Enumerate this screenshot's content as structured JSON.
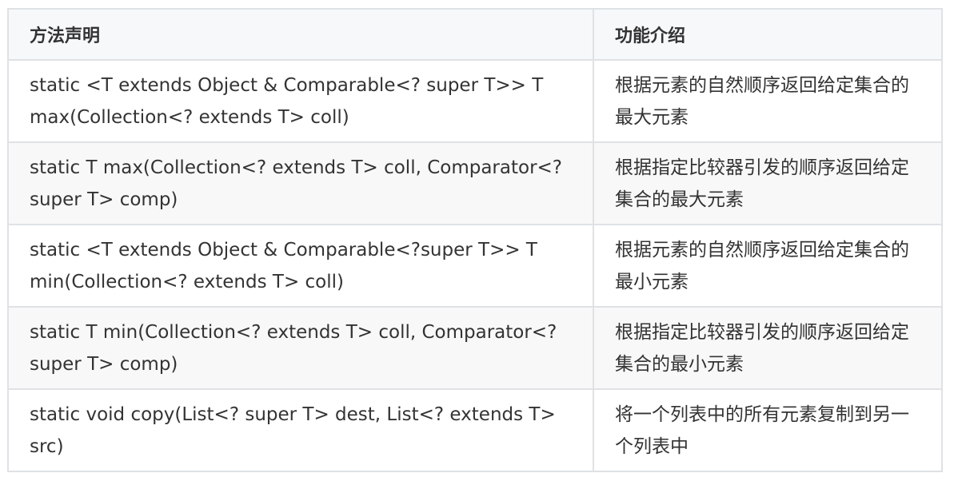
{
  "table": {
    "headers": [
      "方法声明",
      "功能介绍"
    ],
    "rows": [
      {
        "method": "static <T extends Object & Comparable<? super T>> T max(Collection<? extends T> coll)",
        "description": "根据元素的自然顺序返回给定集合的最大元素"
      },
      {
        "method": "static T max(Collection<? extends T> coll, Comparator<? super T> comp)",
        "description": "根据指定比较器引发的顺序返回给定集合的最大元素"
      },
      {
        "method": "static <T extends Object & Comparable<?super T>> T min(Collection<? extends T> coll)",
        "description": "根据元素的自然顺序返回给定集合的最小元素"
      },
      {
        "method": "static T min(Collection<? extends T> coll, Comparator<? super T> comp)",
        "description": "根据指定比较器引发的顺序返回给定集合的最小元素"
      },
      {
        "method": "static void copy(List<? super T> dest, List<? extends T> src)",
        "description": "将一个列表中的所有元素复制到另一个列表中"
      }
    ]
  },
  "colors": {
    "border": "#dfe2e5",
    "header_bg": "#f6f8fa",
    "even_row_bg": "#f8f8f8",
    "text": "#333333"
  }
}
